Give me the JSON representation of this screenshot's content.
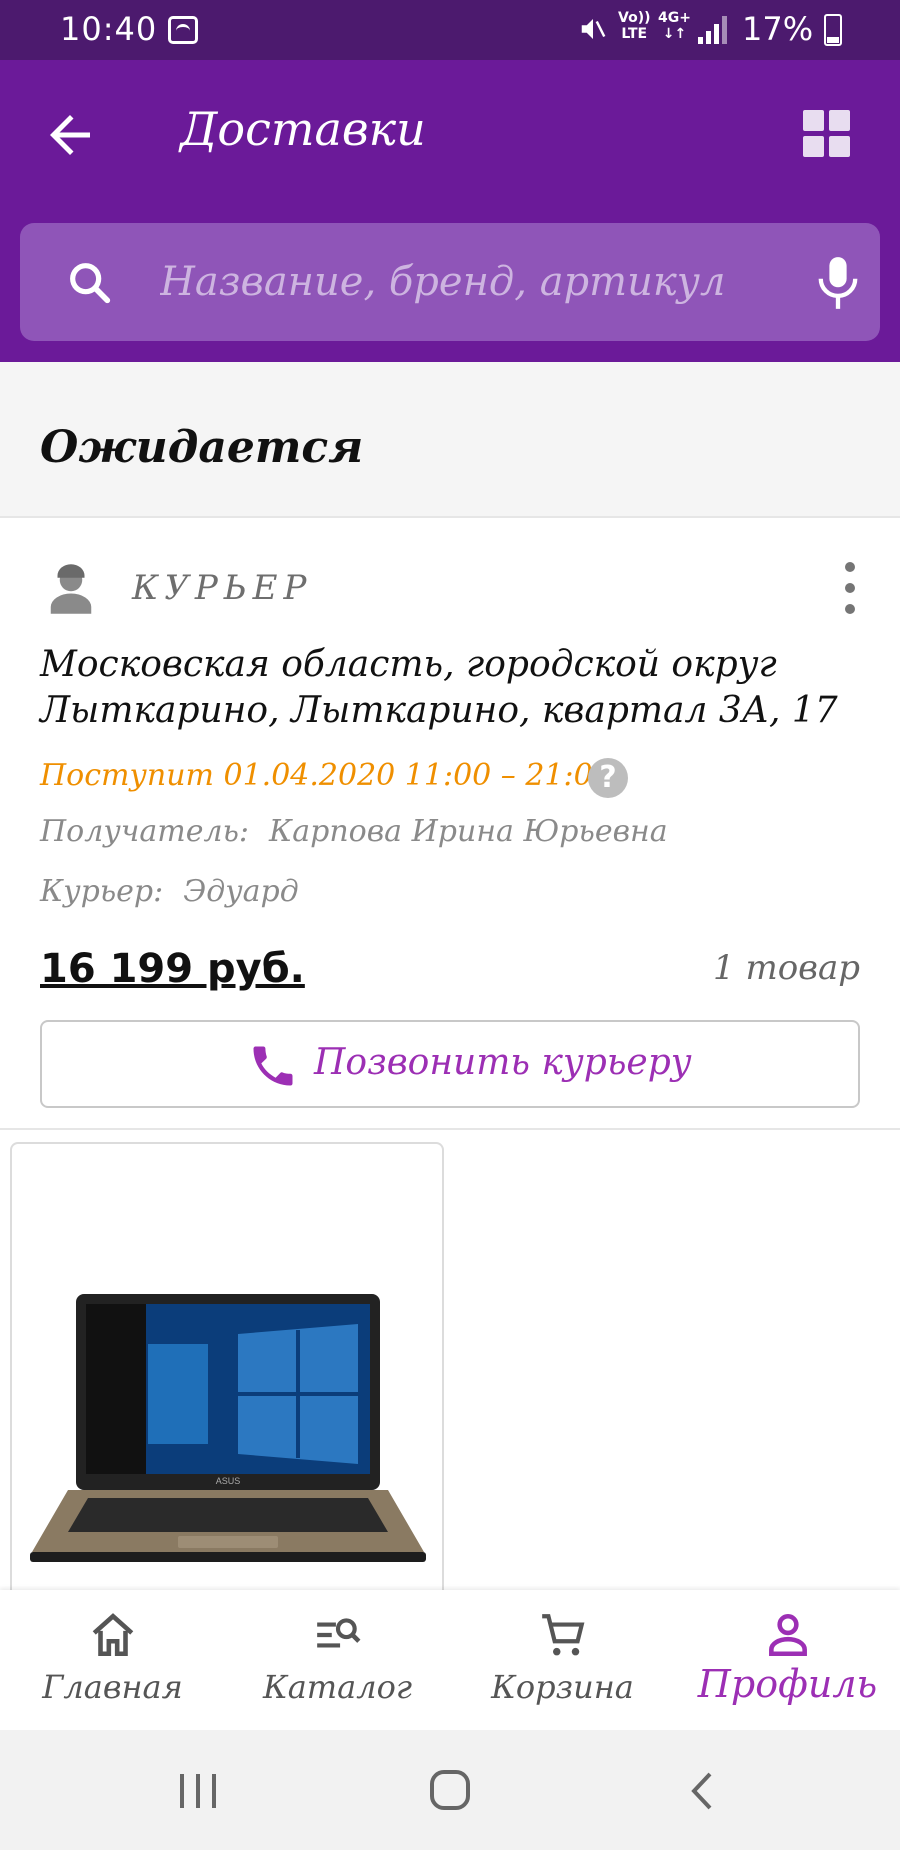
{
  "status_bar": {
    "time": "10:40",
    "volte_line1": "Vo))",
    "volte_line2": "LTE",
    "network_line1": "4G+",
    "network_line2": "↓↑",
    "battery_percent": "17%"
  },
  "header": {
    "title": "Доставки",
    "back_icon": "arrow-left-icon",
    "grid_icon": "grid-icon"
  },
  "search": {
    "placeholder": "Название, бренд, артикул",
    "icon": "search-icon",
    "mic_icon": "microphone-icon"
  },
  "section": {
    "title": "Ожидается"
  },
  "delivery": {
    "type": "КУРЬЕР",
    "address": "Московская область, городской округ Лыткарино, Лыткарино, квартал 3А, 17",
    "eta": "Поступит 01.04.2020 11:00 – 21:00",
    "help": "?",
    "recipient_label": "Получатель:",
    "recipient_value": "Карпова Ирина Юрьевна",
    "courier_label": "Курьер:",
    "courier_value": "Эдуард",
    "price": "16 199 руб.",
    "items_count": "1 товар",
    "call_button": "Позвонить курьеру"
  },
  "product": {
    "brand_on_image": "ASUS"
  },
  "bottom_nav": {
    "items": [
      {
        "label": "Главная",
        "icon": "home-icon"
      },
      {
        "label": "Каталог",
        "icon": "catalog-search-icon"
      },
      {
        "label": "Корзина",
        "icon": "cart-icon"
      },
      {
        "label": "Профиль",
        "icon": "profile-icon"
      }
    ],
    "active_index": 3
  },
  "colors": {
    "status_bar": "#4c1a6e",
    "header": "#6b1a99",
    "search_box": "#8f55b8",
    "accent": "#9c2fb4",
    "eta": "#ef8f00"
  }
}
